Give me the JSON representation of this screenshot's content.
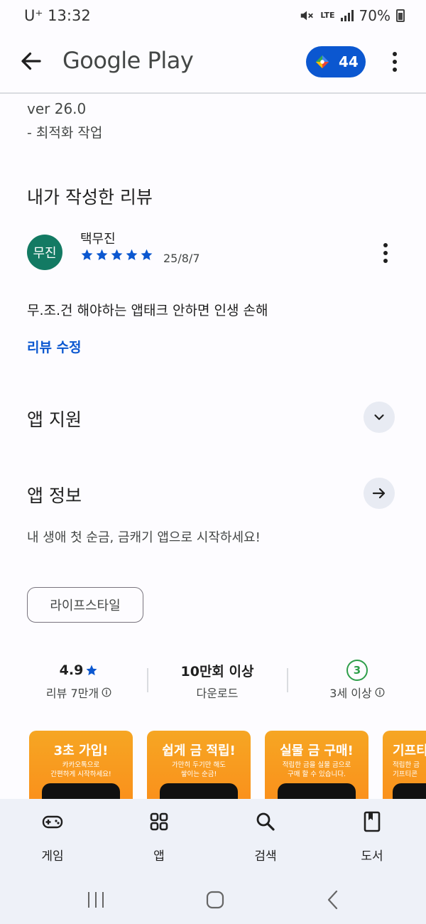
{
  "status_bar": {
    "carrier": "U⁺",
    "time": "13:32",
    "network": "LTE",
    "battery": "70%"
  },
  "app_bar": {
    "title": "Google Play",
    "points": "44",
    "accent_color": "#0b57d0"
  },
  "whats_new": {
    "version": "ver 26.0",
    "note": "- 최적화 작업"
  },
  "my_review": {
    "section_title": "내가 작성한 리뷰",
    "avatar_text": "무진",
    "avatar_color": "#137a63",
    "reviewer": "택무진",
    "rating": 5,
    "date": "25/8/7",
    "text": "무.조.건 해야하는 앱태크 안하면 인생 손해",
    "edit_link": "리뷰 수정"
  },
  "app_support": {
    "title": "앱 지원"
  },
  "app_info": {
    "title": "앱 정보",
    "description": "내 생애 첫 순금, 금캐기 앱으로 시작하세요!",
    "category_chip": "라이프스타일"
  },
  "stats": {
    "rating": "4.9",
    "reviews_label": "리뷰 7만개",
    "downloads": "10만회 이상",
    "downloads_label": "다운로드",
    "age_badge": "3",
    "age_label": "3세 이상"
  },
  "screenshots": [
    {
      "title": "3초 가입!",
      "subtitle": "카카오톡으로\n간편하게 시작하세요!"
    },
    {
      "title": "쉽게 금 적립!",
      "subtitle": "가만히 두기만 해도\n쌓이는 순금!"
    },
    {
      "title": "실물 금 구매!",
      "subtitle": "적립한 금을 실물 금으로\n구매 할 수 있습니다."
    },
    {
      "title": "기프티",
      "subtitle": "적립한 금\n기프티콘"
    }
  ],
  "bottom_nav": [
    {
      "label": "게임",
      "icon": "gamepad-icon"
    },
    {
      "label": "앱",
      "icon": "apps-grid-icon"
    },
    {
      "label": "검색",
      "icon": "search-icon"
    },
    {
      "label": "도서",
      "icon": "book-icon"
    }
  ]
}
